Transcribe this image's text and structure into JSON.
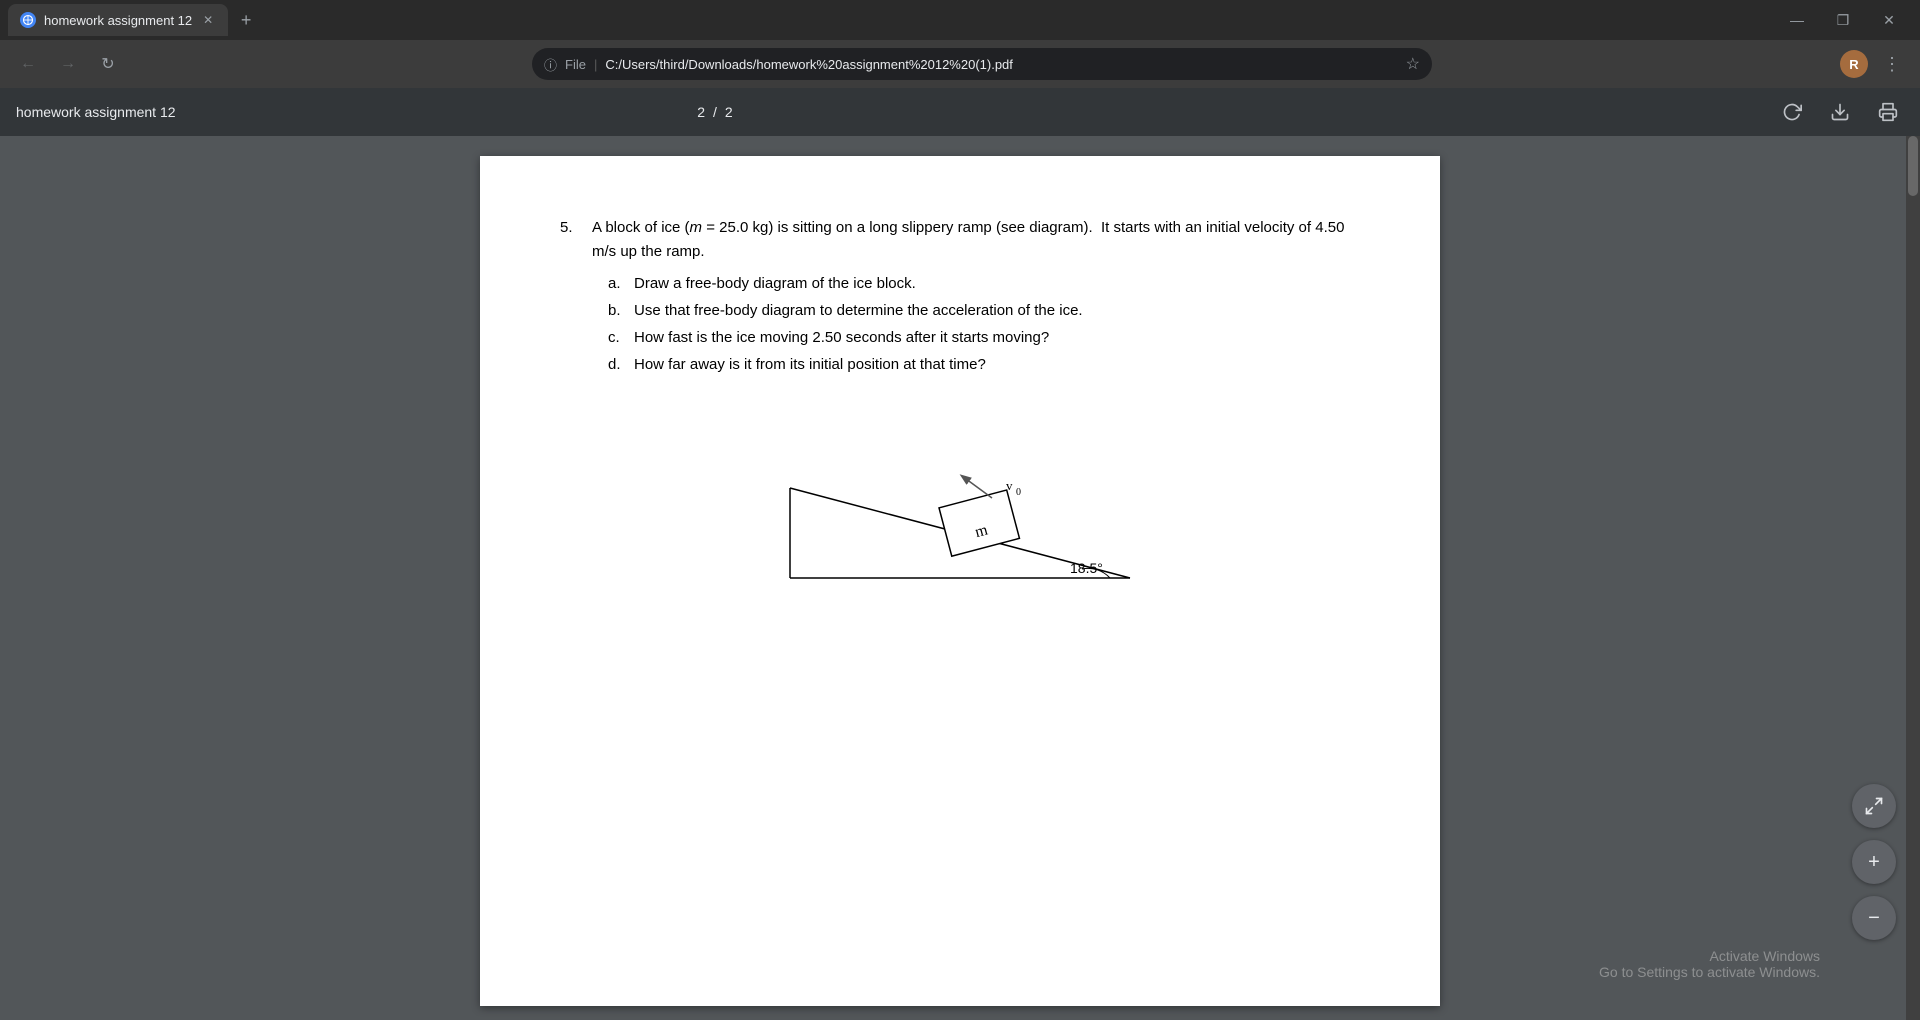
{
  "tab": {
    "title": "homework assignment 12",
    "favicon_label": "globe"
  },
  "window_controls": {
    "minimize": "—",
    "maximize": "❐",
    "close": "✕"
  },
  "address_bar": {
    "file_label": "File",
    "url": "C:/Users/third/Downloads/homework%20assignment%2012%20(1).pdf",
    "separator": "|"
  },
  "pdf_toolbar": {
    "title": "homework assignment 12",
    "page_current": "2",
    "page_separator": "/",
    "page_total": "2"
  },
  "question": {
    "number": "5.",
    "text_part1": "A block of ice (",
    "text_italic": "m",
    "text_part2": " = 25.0 kg) is sitting on a long slippery ramp (see diagram).  It starts with an initial velocity of 4.50 m/s up the ramp.",
    "sub_items": [
      {
        "label": "a.",
        "text": "Draw a free-body diagram of the ice block."
      },
      {
        "label": "b.",
        "text": "Use that free-body diagram to determine the acceleration of the ice."
      },
      {
        "label": "c.",
        "text": "How fast is the ice moving 2.50 seconds after it starts moving?"
      },
      {
        "label": "d.",
        "text": "How far away is it from its initial position at that time?"
      }
    ]
  },
  "diagram": {
    "block_label": "m",
    "velocity_label": "v₀",
    "angle_label": "18.5°"
  },
  "activate_windows": {
    "line1": "Activate Windows",
    "line2": "Go to Settings to activate Windows."
  },
  "float_buttons": {
    "fit": "⤢",
    "zoom_in": "+",
    "zoom_out": "−"
  },
  "user_avatar": "R"
}
